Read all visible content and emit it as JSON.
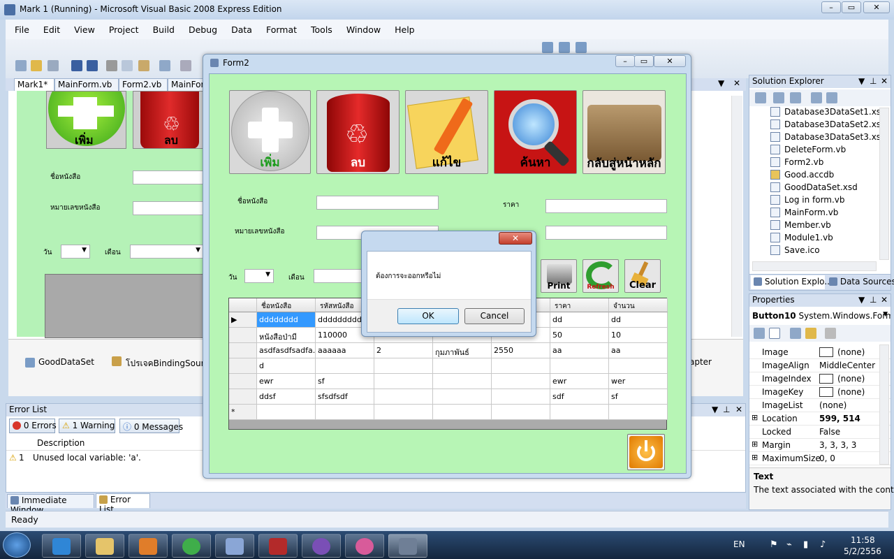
{
  "ide": {
    "title": "Mark 1 (Running) - Microsoft Visual Basic 2008 Express Edition",
    "menu": [
      "File",
      "Edit",
      "View",
      "Project",
      "Build",
      "Debug",
      "Data",
      "Format",
      "Tools",
      "Window",
      "Help"
    ],
    "doc_tabs": [
      "Mark1*",
      "MainForm.vb",
      "Form2.vb",
      "MainForm"
    ],
    "tray_items": [
      "GoodDataSet",
      "โปรเจคBindingSource",
      "apter"
    ],
    "status": "Ready"
  },
  "bgform": {
    "add_label": "เพิ่ม",
    "delete_label": "ลบ",
    "book_name_label": "ชื่อหนังสือ",
    "book_no_label": "หมายเลขหนังสือ",
    "day_label": "วัน",
    "month_label": "เดือน"
  },
  "error_list": {
    "title": "Error List",
    "errors": "0 Errors",
    "warnings": "1 Warning",
    "messages": "0 Messages",
    "col_description": "Description",
    "row_num": "1",
    "row_text": "Unused local variable: 'a'."
  },
  "bottom_tabs": [
    "Immediate Window",
    "Error List"
  ],
  "solution_explorer": {
    "title": "Solution Explorer",
    "items": [
      "Database3DataSet1.xsd",
      "Database3DataSet2.xsd",
      "Database3DataSet3.xsd",
      "DeleteForm.vb",
      "Form2.vb",
      "Good.accdb",
      "GoodDataSet.xsd",
      "Log in form.vb",
      "MainForm.vb",
      "Member.vb",
      "Module1.vb",
      "Save.ico"
    ],
    "tab1": "Solution Explo...",
    "tab2": "Data Sources"
  },
  "properties": {
    "title": "Properties",
    "object": "Button10",
    "object_type": "System.Windows.Forms",
    "rows": [
      {
        "name": "Image",
        "value": "(none)"
      },
      {
        "name": "ImageAlign",
        "value": "MiddleCenter"
      },
      {
        "name": "ImageIndex",
        "value": "(none)"
      },
      {
        "name": "ImageKey",
        "value": "(none)"
      },
      {
        "name": "ImageList",
        "value": "(none)"
      },
      {
        "name": "Location",
        "value": "599, 514"
      },
      {
        "name": "Locked",
        "value": "False"
      },
      {
        "name": "Margin",
        "value": "3, 3, 3, 3"
      },
      {
        "name": "MaximumSize",
        "value": "0, 0"
      }
    ],
    "desc_title": "Text",
    "desc_text": "The text associated with the control."
  },
  "form2": {
    "title": "Form2",
    "buttons": {
      "add": "เพิ่ม",
      "delete": "ลบ",
      "edit": "แก้ไข",
      "search": "ค้นหา",
      "back": "กลับสู่หน้าหลัก"
    },
    "book_name_label": "ชื่อหนังสือ",
    "book_no_label": "หมายเลขหนังสือ",
    "price_label": "ราคา",
    "day_label": "วัน",
    "month_label": "เดือน",
    "print": "Print",
    "refresh": "Refresh",
    "clear": "Clear",
    "grid": {
      "headers": [
        "ชื่อหนังสือ",
        "รหัสหนังสือ",
        "",
        "",
        "",
        "ราคา",
        "จำนวน"
      ],
      "rows": [
        [
          "dddddddd",
          "dddddddddd",
          "",
          "",
          "",
          "dd",
          "dd"
        ],
        [
          "หนังสือป่ามี",
          "110000",
          "",
          "",
          "",
          "50",
          "10"
        ],
        [
          "asdfasdfsadfa...",
          "aaaaaa",
          "2",
          "กุมภาพันธ์",
          "2550",
          "aa",
          "aa"
        ],
        [
          "d",
          "",
          "",
          "",
          "",
          "",
          ""
        ],
        [
          "ewr",
          "sf",
          "",
          "",
          "",
          "ewr",
          "wer"
        ],
        [
          "ddsf",
          "sfsdfsdf",
          "",
          "",
          "",
          "sdf",
          "sf"
        ]
      ]
    }
  },
  "dialog": {
    "message": "ต้องการจะออกหรือไม่",
    "ok": "OK",
    "cancel": "Cancel"
  },
  "taskbar": {
    "lang": "EN",
    "time": "11:58",
    "date": "5/2/2556"
  }
}
